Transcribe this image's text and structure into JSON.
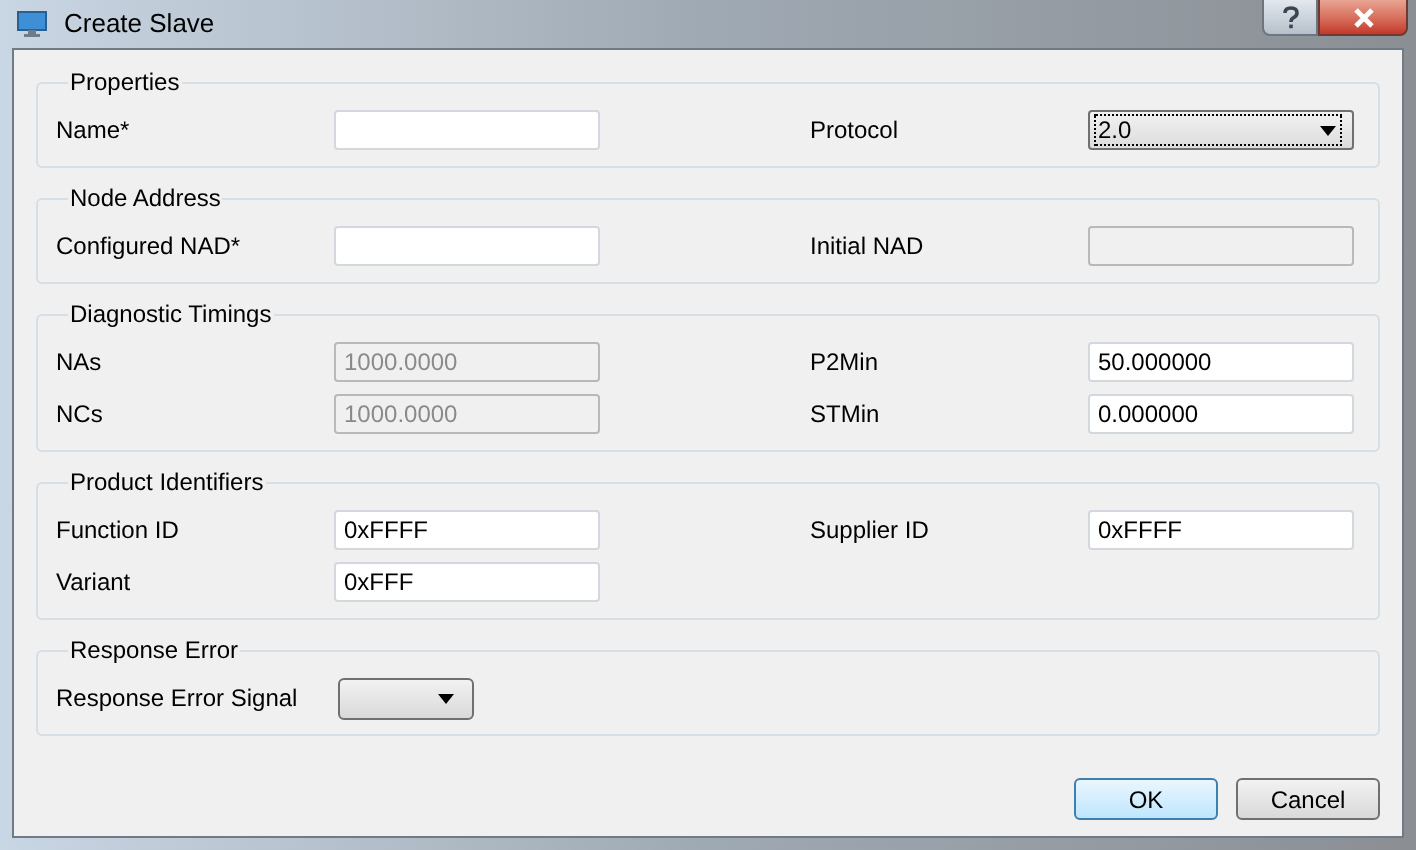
{
  "window": {
    "title": "Create Slave"
  },
  "groups": [
    {
      "title": "Properties",
      "rows": [
        {
          "left": {
            "label": "Name*",
            "kind": "text",
            "disabled": false
          },
          "right": {
            "label": "Protocol",
            "kind": "combo",
            "value": "2.0",
            "focused": true
          }
        }
      ]
    },
    {
      "title": "Node Address",
      "rows": [
        {
          "left": {
            "label": "Configured NAD*",
            "kind": "text",
            "disabled": false
          },
          "right": {
            "label": "Initial NAD",
            "kind": "text",
            "disabled": true
          }
        }
      ]
    },
    {
      "title": "Diagnostic Timings",
      "rows": [
        {
          "left": {
            "label": "NAs",
            "kind": "text",
            "value": "1000.0000",
            "disabled": true
          },
          "right": {
            "label": "P2Min",
            "kind": "text",
            "value": "50.000000",
            "disabled": false
          }
        },
        {
          "left": {
            "label": "NCs",
            "kind": "text",
            "value": "1000.0000",
            "disabled": true
          },
          "right": {
            "label": "STMin",
            "kind": "text",
            "value": "0.000000",
            "disabled": false
          }
        }
      ]
    },
    {
      "title": "Product Identifiers",
      "rows": [
        {
          "left": {
            "label": "Function ID",
            "kind": "text",
            "value": "0xFFFF",
            "disabled": false
          },
          "right": {
            "label": "Supplier ID",
            "kind": "text",
            "value": "0xFFFF",
            "disabled": false
          }
        },
        {
          "left": {
            "label": "Variant",
            "kind": "text",
            "value": "0xFFF",
            "disabled": false
          }
        }
      ]
    },
    {
      "title": "Response Error",
      "rows": [
        {
          "left": {
            "label": "Response Error Signal",
            "kind": "small_combo",
            "focused": false
          }
        }
      ]
    }
  ],
  "buttons": [
    {
      "label": "OK",
      "default": true
    },
    {
      "label": "Cancel",
      "default": false
    }
  ]
}
